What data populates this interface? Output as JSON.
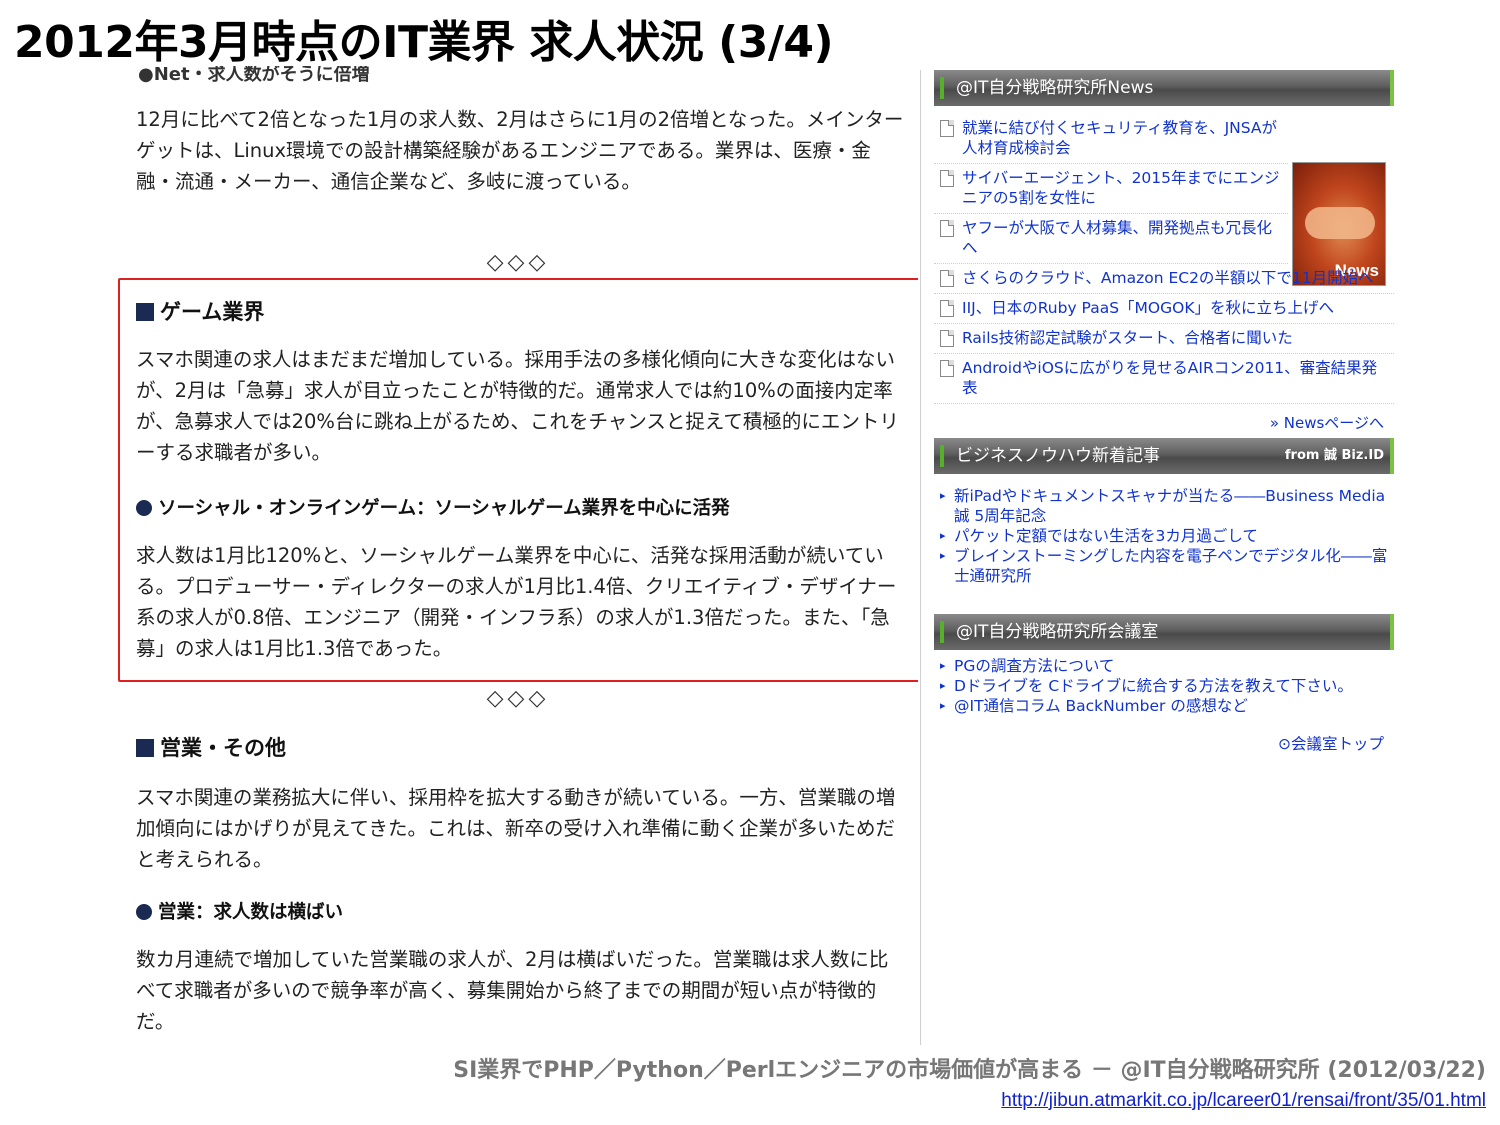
{
  "slide_title": "2012年3月時点のIT業界 求人状況 (3/4)",
  "article": {
    "cut_line": "●Net・求人数がそうに倍増",
    "intro_paragraph": "12月に比べて2倍となった1月の求人数、2月はさらに1月の2倍増となった。メインターゲットは、Linux環境での設計構築経験があるエンジニアである。業界は、医療・金融・流通・メーカー、通信企業など、多岐に渡っている。",
    "diamonds": "◇◇◇",
    "game_section": {
      "heading": "ゲーム業界",
      "paragraph": "スマホ関連の求人はまだまだ増加している。採用手法の多様化傾向に大きな変化はないが、2月は「急募」求人が目立ったことが特徴的だ。通常求人では約10%の面接内定率が、急募求人では20%台に跳ね上がるため、これをチャンスと捉えて積極的にエントリーする求職者が多い。",
      "subheading": "ソーシャル・オンラインゲーム：ソーシャルゲーム業界を中心に活発",
      "subparagraph": "求人数は1月比120%と、ソーシャルゲーム業界を中心に、活発な採用活動が続いている。プロデューサー・ディレクターの求人が1月比1.4倍、クリエイティブ・デザイナー系の求人が0.8倍、エンジニア（開発・インフラ系）の求人が1.3倍だった。また、「急募」の求人は1月比1.3倍であった。"
    },
    "sales_section": {
      "heading": "営業・その他",
      "paragraph": "スマホ関連の業務拡大に伴い、採用枠を拡大する動きが続いている。一方、営業職の増加傾向にはかげりが見えてきた。これは、新卒の受け入れ準備に動く企業が多いためだと考えられる。",
      "subheading": "営業：求人数は横ばい",
      "subparagraph": "数カ月連続で増加していた営業職の求人が、2月は横ばいだった。営業職は求人数に比べて求職者が多いので競争率が高く、募集開始から終了までの期間が短い点が特徴的だ。"
    }
  },
  "sidebar": {
    "news_box": {
      "title": "@IT自分戦略研究所News",
      "thumb_label": "News",
      "items": [
        "就業に結び付くセキュリティ教育を、JNSAが人材育成検討会",
        "サイバーエージェント、2015年までにエンジニアの5割を女性に",
        "ヤフーが大阪で人材募集、開発拠点も冗長化へ",
        "さくらのクラウド、Amazon EC2の半額以下で11月開始へ",
        "IIJ、日本のRuby PaaS「MOGOK」を秋に立ち上げへ",
        "Rails技術認定試験がスタート、合格者に聞いた",
        "AndroidやiOSに広がりを見せるAIRコン2011、審査結果発表"
      ],
      "more_link": "» Newsページへ"
    },
    "biz_box": {
      "title": "ビジネスノウハウ新着記事",
      "from_label": "from 誠 Biz.ID",
      "items": [
        "新iPadやドキュメントスキャナが当たる――Business Media 誠 5周年記念",
        "パケット定額ではない生活を3カ月過ごして",
        "ブレインストーミングした内容を電子ペンでデジタル化――富士通研究所"
      ]
    },
    "meeting_box": {
      "title": "@IT自分戦略研究所会議室",
      "items": [
        "PGの調査方法について",
        "Dドライブを Cドライブに統合する方法を教えて下さい。",
        "@IT通信コラム BackNumber の感想など"
      ],
      "top_link": "⊙会議室トップ"
    }
  },
  "footer": {
    "source": "SI業界でPHP／Python／Perlエンジニアの市場価値が高まる － @IT自分戦略研究所 (2012/03/22)",
    "url": "http://jibun.atmarkit.co.jp/lcareer01/rensai/front/35/01.html"
  },
  "colors": {
    "highlight_border": "#e02020",
    "link": "#1133cc",
    "heading_marker": "#1b2a52",
    "sidebar_accent": "#56b02b"
  }
}
